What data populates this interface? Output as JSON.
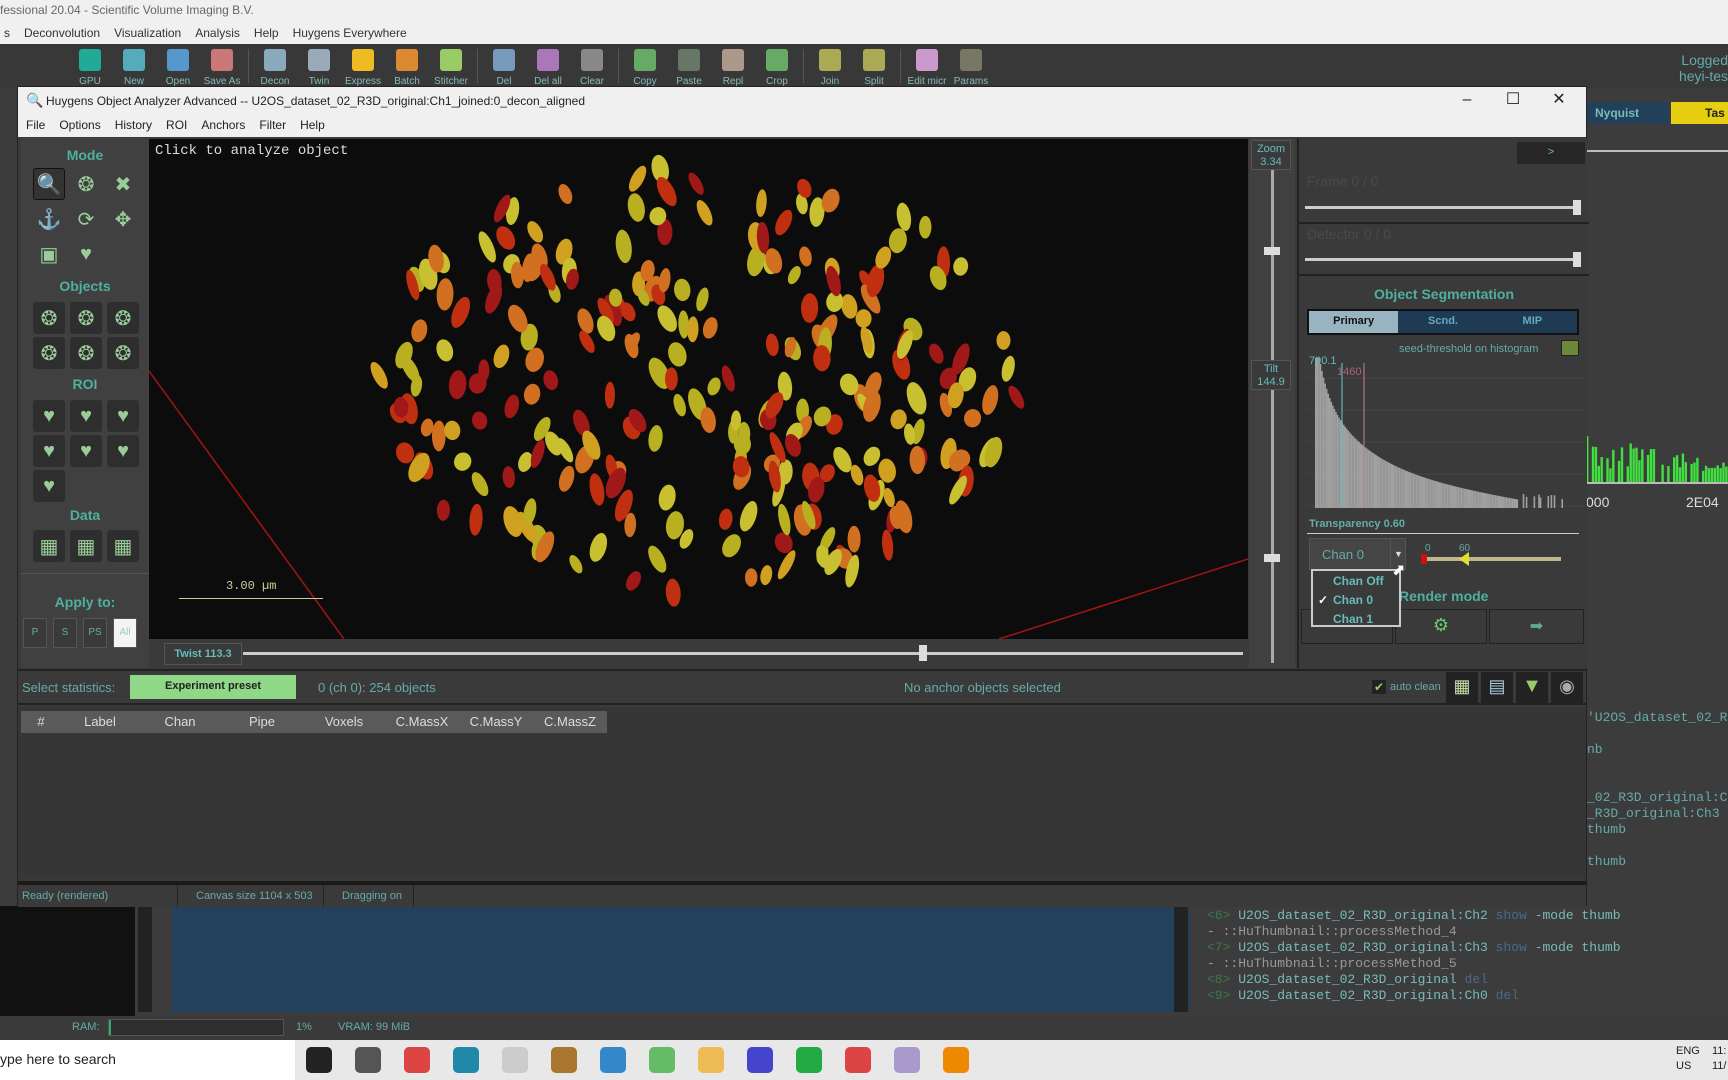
{
  "app": {
    "title": "fessional 20.04 - Scientific Volume Imaging B.V.",
    "menu": [
      "s",
      "Deconvolution",
      "Visualization",
      "Analysis",
      "Help",
      "Huygens Everywhere"
    ],
    "toolbar": [
      {
        "label": "GPU",
        "color": "#2a9"
      },
      {
        "label": "New",
        "color": "#5ab"
      },
      {
        "label": "Open",
        "color": "#59c"
      },
      {
        "label": "Save As",
        "color": "#c77"
      },
      null,
      {
        "label": "Decon",
        "color": "#8ab"
      },
      {
        "label": "Twin",
        "color": "#9ab"
      },
      {
        "label": "Express",
        "color": "#eb2"
      },
      {
        "label": "Batch",
        "color": "#d83"
      },
      {
        "label": "Stitcher",
        "color": "#9c6"
      },
      null,
      {
        "label": "Del",
        "color": "#79b"
      },
      {
        "label": "Del all",
        "color": "#a7b"
      },
      {
        "label": "Clear",
        "color": "#888"
      },
      null,
      {
        "label": "Copy",
        "color": "#6a6"
      },
      {
        "label": "Paste",
        "color": "#676"
      },
      {
        "label": "Repl",
        "color": "#a98"
      },
      {
        "label": "Crop",
        "color": "#6a6"
      },
      null,
      {
        "label": "Join",
        "color": "#aa5"
      },
      {
        "label": "Split",
        "color": "#aa5"
      },
      null,
      {
        "label": "Edit micr",
        "color": "#c9c"
      },
      {
        "label": "Params",
        "color": "#776"
      }
    ],
    "logged": [
      "Logged",
      "heyi-tes"
    ],
    "tabs": {
      "nyquist": "Nyquist",
      "tasks": "Tas"
    },
    "hist_labels": [
      "000",
      "2E04"
    ]
  },
  "dialog": {
    "title": "Huygens Object Analyzer Advanced -- U2OS_dataset_02_R3D_original:Ch1_joined:0_decon_aligned",
    "menu": [
      "File",
      "Options",
      "History",
      "ROI",
      "Anchors",
      "Filter",
      "Help"
    ],
    "left": {
      "mode": "Mode",
      "objects": "Objects",
      "roi": "ROI",
      "data": "Data",
      "apply": "Apply to:",
      "apply_buttons": [
        "P",
        "S",
        "PS",
        "All"
      ],
      "apply_selected": "All",
      "mode_icons": [
        "magnifier-icon",
        "lasso-icon",
        "close-x-icon",
        "anchor-icon",
        "rotate-box-icon",
        "move-arrows-icon",
        "add-region-icon",
        "heart-region-icon"
      ]
    },
    "canvas": {
      "hint": "Click to analyze object",
      "scale_bar": "3.00 µm"
    },
    "zoom": {
      "label": "Zoom",
      "value": "3.34"
    },
    "tilt": {
      "label": "Tilt",
      "value": "144.9"
    },
    "twist": {
      "label": "Twist",
      "value": "113.3"
    },
    "right": {
      "expand": ">",
      "frame": "Frame  0 / 0",
      "detector": "Detector  0 / 0",
      "seg_title": "Object Segmentation",
      "seg_tabs": [
        "Primary",
        "Scnd.",
        "MIP"
      ],
      "seg_active": "Primary",
      "seed": "seed-threshold on histogram",
      "thr1": "790.1",
      "thr2": "1460",
      "transparency": "Transparency 0.60",
      "chan": "Chan 0",
      "range_min": "0",
      "range_val": "60",
      "chan_options": [
        "Chan Off",
        "Chan 0",
        "Chan 1"
      ],
      "chan_checked": "Chan 0",
      "render": "Render mode"
    },
    "stats": {
      "label": "Select statistics:",
      "preset": "Experiment preset",
      "count": "0 (ch 0): 254 objects",
      "anchor": "No anchor objects selected",
      "auto_clean": "auto clean",
      "auto_clean_checked": true
    },
    "table": {
      "columns": [
        "#",
        "Label",
        "Chan",
        "Pipe",
        "Voxels",
        "C.MassX",
        "C.MassY",
        "C.MassZ"
      ]
    },
    "status": [
      "Ready (rendered)",
      "Canvas size 1104 x 503",
      "Dragging on"
    ]
  },
  "log": [
    {
      "text": "'U2OS_dataset_02_R"
    },
    {
      "text": ""
    },
    {
      "text": "nb"
    },
    {
      "text": ""
    },
    {
      "text": ""
    },
    {
      "text": "_02_R3D_original:C"
    },
    {
      "text": "_R3D_original:Ch3"
    },
    {
      "text": "thumb"
    },
    {
      "text": ""
    },
    {
      "text": "thumb"
    }
  ],
  "log_tail": [
    {
      "n": "<6>",
      "obj": "U2OS_dataset_02_R3D_original:Ch2",
      "cmd": "show",
      "rest": "-mode thumb"
    },
    {
      "plain": "- ::HuThumbnail::processMethod_4"
    },
    {
      "n": "<7>",
      "obj": "U2OS_dataset_02_R3D_original:Ch3",
      "cmd": "show",
      "rest": "-mode thumb"
    },
    {
      "plain": "- ::HuThumbnail::processMethod_5"
    },
    {
      "n": "<8>",
      "obj": "U2OS_dataset_02_R3D_original",
      "cmd": "del",
      "rest": ""
    },
    {
      "n": "<9>",
      "obj": "U2OS_dataset_02_R3D_original:Ch0",
      "cmd": "del",
      "rest": ""
    }
  ],
  "ram": {
    "label": "RAM:",
    "percent": "1%",
    "vram": "VRAM: 99 MiB"
  },
  "taskbar": {
    "search": "ype here to search",
    "lang": [
      "ENG",
      "US"
    ],
    "clock": [
      "11:",
      "11/"
    ]
  }
}
